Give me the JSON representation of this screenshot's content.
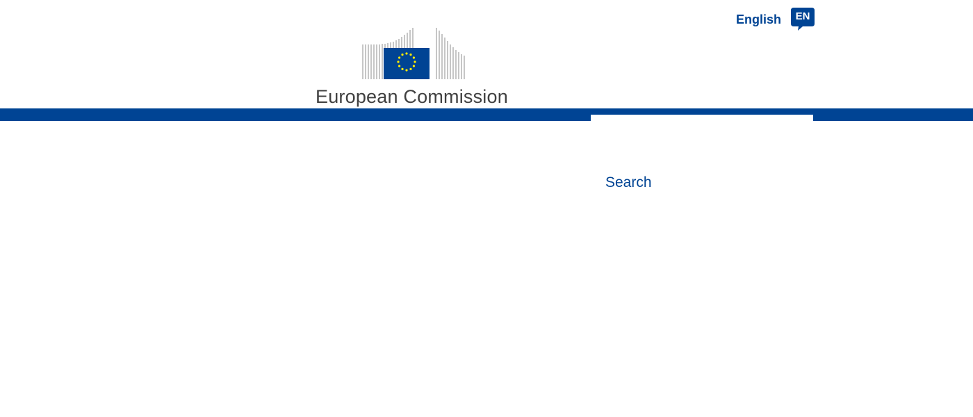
{
  "header": {
    "language": {
      "label": "English",
      "code": "EN",
      "icon": "speech-bubble-icon"
    },
    "logo": {
      "text": "European Commission",
      "icon": "eu-flag-building-icon"
    }
  },
  "search": {
    "label": "Search"
  },
  "colors": {
    "brand_blue": "#004494",
    "flag_star": "#FFED00",
    "logo_text": "#404040"
  }
}
